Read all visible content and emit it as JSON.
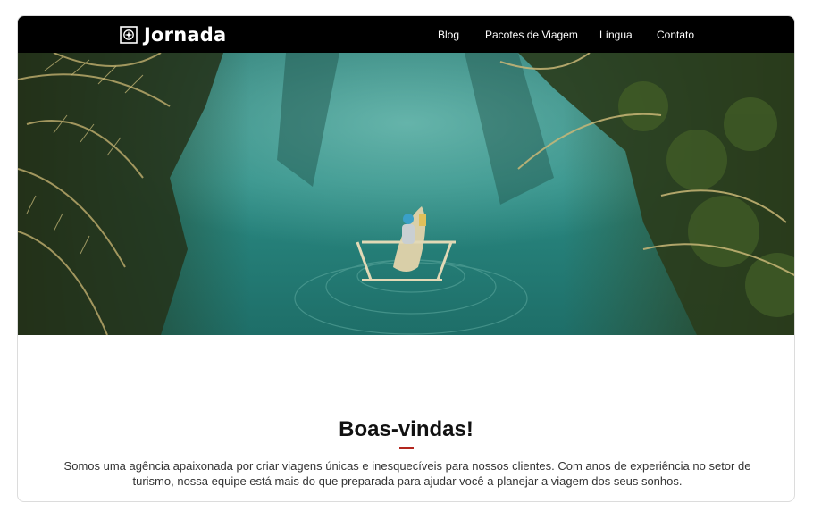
{
  "brand": {
    "name": "Jornada",
    "icon": "compass-icon"
  },
  "nav": {
    "blog": "Blog",
    "packages": "Pacotes de Viagem",
    "language": "Língua",
    "contact": "Contato"
  },
  "hero": {
    "image": "river-canoe-photo"
  },
  "welcome": {
    "title": "Boas-vindas!",
    "body": "Somos uma agência apaixonada por criar viagens únicas e inesquecíveis para nossos clientes. Com anos de experiência no setor de turismo, nossa equipe está mais do que preparada para ajudar você a planejar a viagem dos seus sonhos.",
    "accent_color": "#b3261e"
  }
}
